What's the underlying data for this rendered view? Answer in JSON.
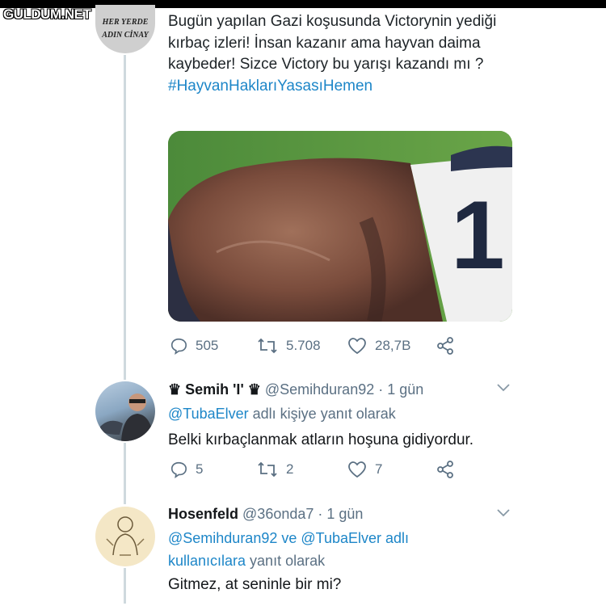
{
  "watermark": "GULDUM.NET",
  "top_tweet": {
    "avatar_text_1": "HER YERDE",
    "avatar_text_2": "ADIN CİNAY",
    "text": "Bugün yapılan Gazi koşusunda Victorynin yediği kırbaç izleri! İnsan kazanır ama hayvan daima kaybeder! Sizce Victory bu yarışı kazandı mı ?",
    "hashtag": "#HayvanHaklarıYasasıHemen",
    "media_number": "1",
    "replies": "505",
    "retweets": "5.708",
    "likes": "28,7B"
  },
  "reply1": {
    "display_name": "♛ Semih 'I' ♛",
    "handle": "@Semihduran92 · 1 gün",
    "reply_mention": "@TubaElver",
    "reply_suffix": " adlı kişiye yanıt olarak",
    "text": "Belki kırbaçlanmak atların hoşuna gidiyordur.",
    "replies": "5",
    "retweets": "2",
    "likes": "7"
  },
  "reply2": {
    "display_name": "Hosenfeld",
    "handle": "@36onda7 · 1 gün",
    "mention1": "@Semihduran92",
    "joiner": " ve ",
    "mention2": "@TubaElver",
    "mention_tail": " adlı",
    "mention_line2": "kullanıcılara",
    "reply_suffix": " yanıt olarak",
    "text": "Gitmez, at seninle bir mi?"
  },
  "colors": {
    "link": "#1d86c8",
    "muted": "#5b7083",
    "thread": "#cfd9de"
  }
}
